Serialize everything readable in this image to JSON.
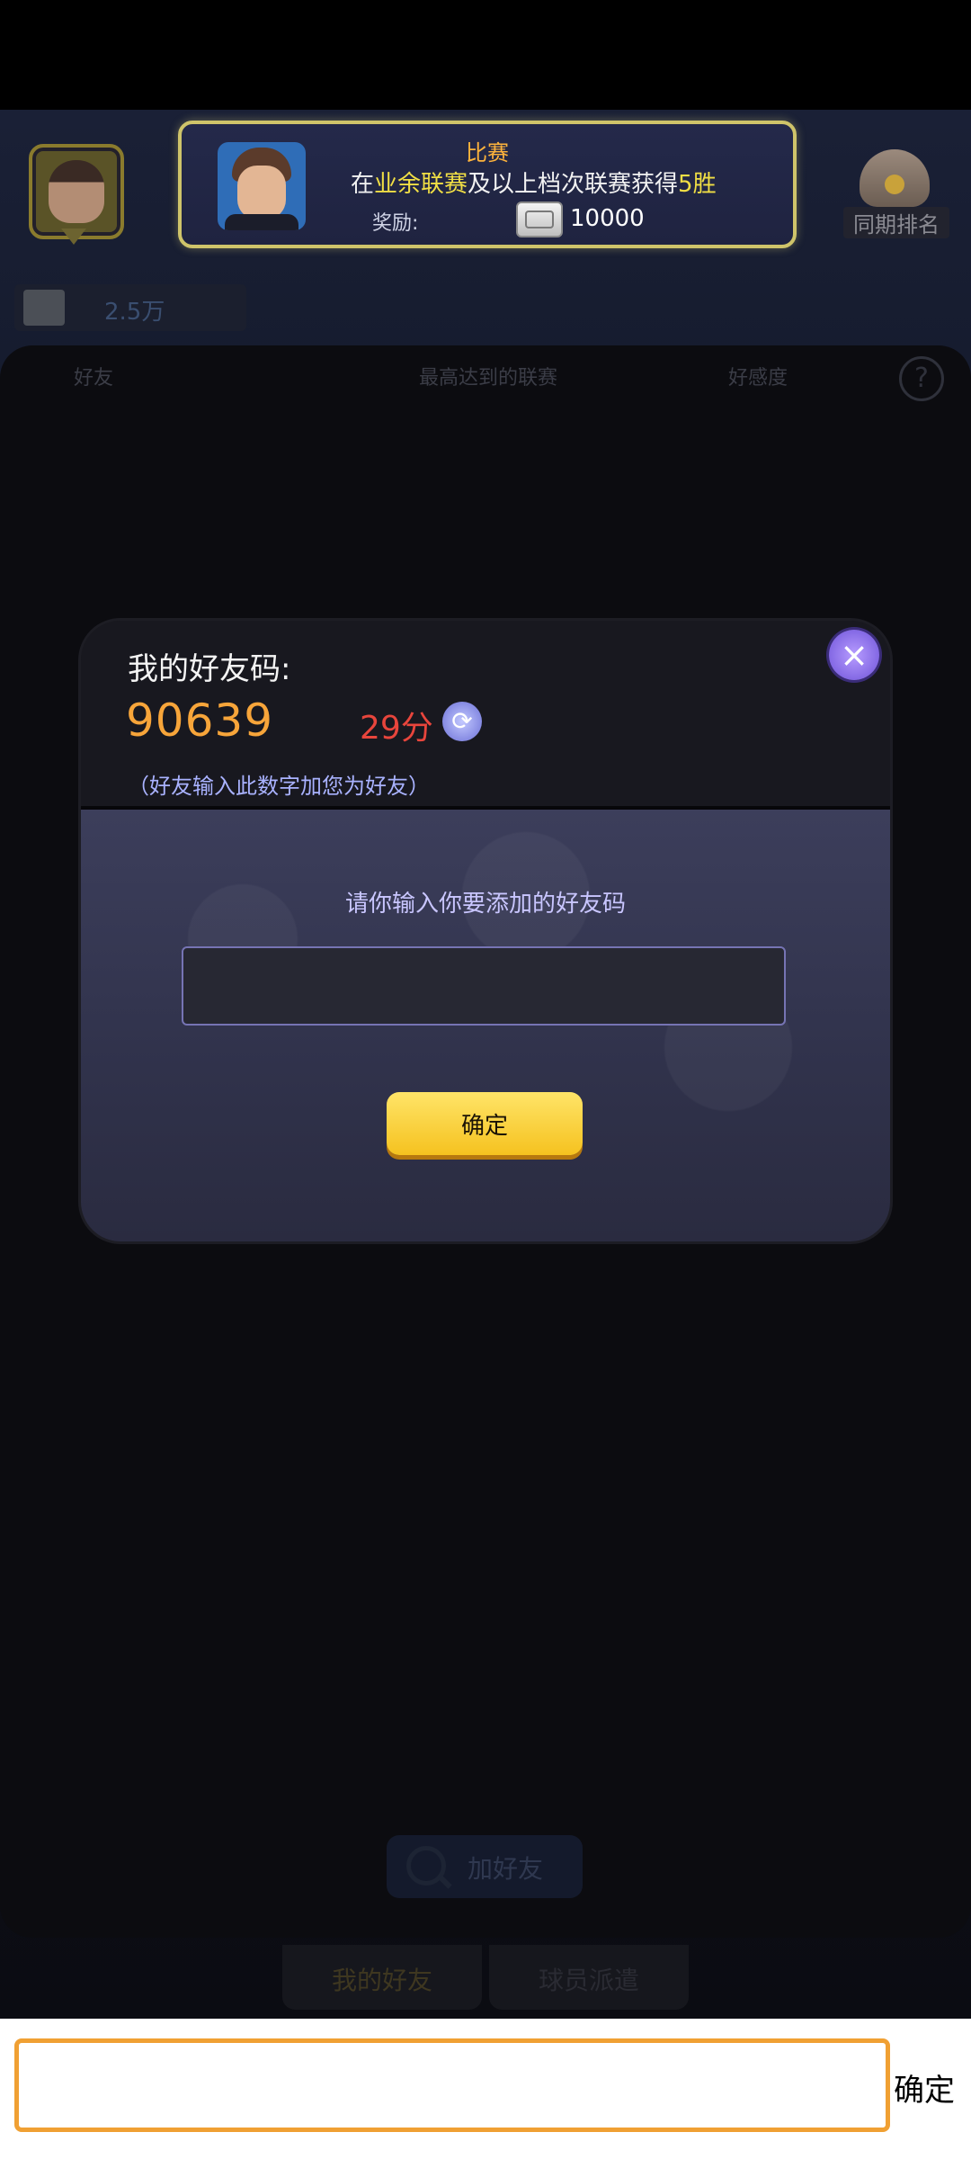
{
  "top_bar": {
    "banner": {
      "title": "比赛",
      "desc_prefix": "在",
      "desc_highlight": "业余联赛",
      "desc_middle": "及以上档次联赛获得",
      "desc_win": "5胜",
      "reward_label": "奖励:",
      "reward_value": "10000"
    },
    "ranking_label": "同期排名",
    "money_value": "2.5万"
  },
  "friend_panel": {
    "columns": [
      "好友",
      "最高达到的联赛",
      "好感度"
    ],
    "help": "?",
    "add_friend_label": "加好友",
    "tabs": [
      "我的好友",
      "球员派遣"
    ]
  },
  "dialog": {
    "my_code_label": "我的好友码:",
    "my_code": "90639",
    "timer": "29分",
    "hint": "（好友输入此数字加您为好友）",
    "input_prompt": "请你输入你要添加的好友码",
    "input_value": "",
    "confirm_label": "确定",
    "close": "×"
  },
  "ime_bar": {
    "input_value": "",
    "confirm_label": "确定"
  },
  "colors": {
    "code": "#f7a53a",
    "timer": "#e8453c",
    "hint": "#a9b2ff",
    "confirm": "#ffd43b",
    "ime_border": "#f0a033"
  },
  "icons": [
    "refresh-icon",
    "close-icon",
    "cash-icon",
    "search-icon",
    "help-icon",
    "medal-icon"
  ]
}
